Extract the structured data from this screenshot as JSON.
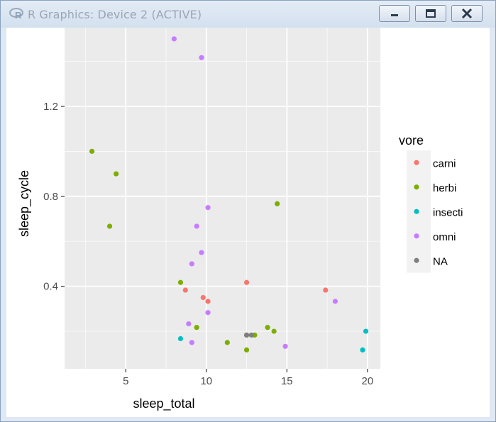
{
  "window": {
    "title": "R Graphics: Device 2 (ACTIVE)"
  },
  "colors": {
    "panel": "#ebebeb",
    "carni": "#F8766D",
    "herbi": "#7CAE00",
    "insecti": "#00BFC4",
    "omni": "#C77CFF",
    "NA": "#7F7F7F"
  },
  "chart_data": {
    "type": "scatter",
    "xlabel": "sleep_total",
    "ylabel": "sleep_cycle",
    "xlim": [
      1.2,
      20.8
    ],
    "ylim": [
      0.033,
      1.55
    ],
    "x_ticks": [
      5,
      10,
      15,
      20
    ],
    "x_tick_labels": [
      "5",
      "10",
      "15",
      "20"
    ],
    "y_ticks": [
      0.4,
      0.8,
      1.2
    ],
    "y_tick_labels": [
      "0.4",
      "0.8",
      "1.2"
    ],
    "grid": true,
    "legend": {
      "title": "vore",
      "position": "right",
      "entries": [
        "carni",
        "herbi",
        "insecti",
        "omni",
        "NA"
      ]
    },
    "series": [
      {
        "name": "carni",
        "points": [
          [
            8.7,
            0.383
          ],
          [
            9.8,
            0.35
          ],
          [
            10.1,
            0.333
          ],
          [
            12.5,
            0.417
          ],
          [
            17.4,
            0.383
          ]
        ]
      },
      {
        "name": "herbi",
        "points": [
          [
            2.9,
            1.0
          ],
          [
            4.4,
            0.9
          ],
          [
            4.0,
            0.667
          ],
          [
            8.4,
            0.417
          ],
          [
            9.4,
            0.217
          ],
          [
            11.3,
            0.15
          ],
          [
            12.5,
            0.183
          ],
          [
            12.5,
            0.117
          ],
          [
            13.0,
            0.183
          ],
          [
            13.8,
            0.217
          ],
          [
            14.2,
            0.2
          ],
          [
            14.4,
            0.767
          ]
        ]
      },
      {
        "name": "insecti",
        "points": [
          [
            8.4,
            0.167
          ],
          [
            19.7,
            0.117
          ],
          [
            19.9,
            0.2
          ]
        ]
      },
      {
        "name": "omni",
        "points": [
          [
            8.0,
            1.5
          ],
          [
            9.7,
            1.417
          ],
          [
            10.1,
            0.75
          ],
          [
            9.4,
            0.667
          ],
          [
            9.7,
            0.55
          ],
          [
            9.1,
            0.5
          ],
          [
            10.1,
            0.283
          ],
          [
            8.9,
            0.233
          ],
          [
            9.1,
            0.15
          ],
          [
            14.9,
            0.133
          ],
          [
            18.0,
            0.333
          ]
        ]
      },
      {
        "name": "NA",
        "points": [
          [
            12.5,
            0.183
          ],
          [
            12.8,
            0.183
          ]
        ]
      }
    ]
  }
}
